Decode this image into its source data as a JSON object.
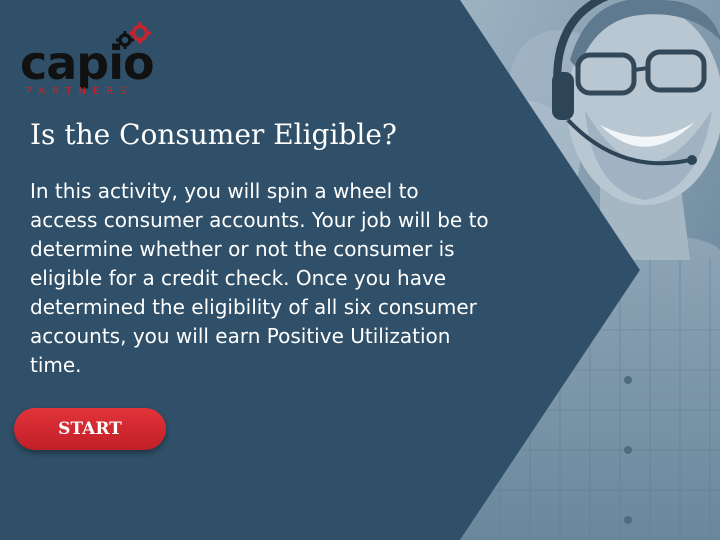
{
  "logo": {
    "word": "capio",
    "sub": "PARTNERS",
    "gear_icon": "gears-icon",
    "colors": {
      "dark": "#111111",
      "accent": "#c8232c"
    }
  },
  "title": "Is the Consumer Eligible?",
  "body": "In this activity, you will spin a wheel to access consumer accounts. Your job will be to determine whether or not the consumer is eligible for a credit check. Once you have determined the eligibility of all six consumer accounts, you will earn Positive Utilization time.",
  "start_button": {
    "label": "START",
    "color": "#d42a31"
  },
  "colors": {
    "background": "#2f5068",
    "text": "#ffffff"
  }
}
